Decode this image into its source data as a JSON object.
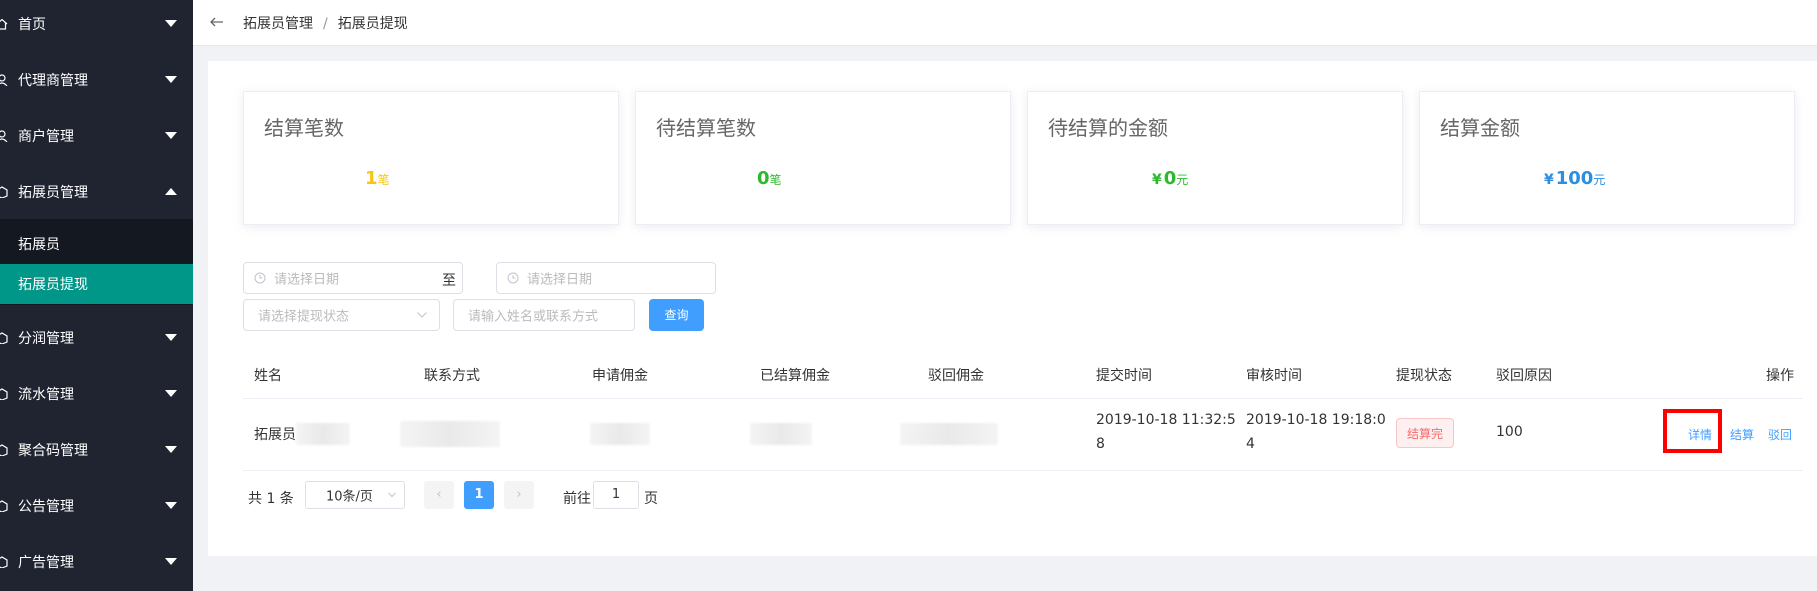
{
  "sidebar": {
    "menu": [
      {
        "label": "首页",
        "icon": "home-icon",
        "expanded": false
      },
      {
        "label": "代理商管理",
        "icon": "user-icon",
        "expanded": false
      },
      {
        "label": "商户管理",
        "icon": "user-icon",
        "expanded": false
      },
      {
        "label": "拓展员管理",
        "icon": "box-icon",
        "expanded": true
      },
      {
        "label": "分润管理",
        "icon": "box-icon",
        "expanded": false
      },
      {
        "label": "流水管理",
        "icon": "box-icon",
        "expanded": false
      },
      {
        "label": "聚合码管理",
        "icon": "box-icon",
        "expanded": false
      },
      {
        "label": "公告管理",
        "icon": "box-icon",
        "expanded": false
      },
      {
        "label": "广告管理",
        "icon": "box-icon",
        "expanded": false
      }
    ],
    "submenu": [
      {
        "label": "拓展员",
        "active": false
      },
      {
        "label": "拓展员提现",
        "active": true
      }
    ]
  },
  "header": {
    "breadcrumb": [
      "拓展员管理",
      "拓展员提现"
    ],
    "separator": "/"
  },
  "stats": [
    {
      "title": "结算笔数",
      "value": "1",
      "unit": "笔",
      "currency": "",
      "color": "#f5c518"
    },
    {
      "title": "待结算笔数",
      "value": "0",
      "unit": "笔",
      "currency": "",
      "color": "#2eb82e"
    },
    {
      "title": "待结算的金额",
      "value": "0",
      "unit": "元",
      "currency": "¥",
      "color": "#2eb82e"
    },
    {
      "title": "结算金额",
      "value": "100",
      "unit": "元",
      "currency": "¥",
      "color": "#2b8ee0"
    }
  ],
  "filters": {
    "date_start_placeholder": "请选择日期",
    "to_label": "至",
    "date_end_placeholder": "请选择日期",
    "status_placeholder": "请选择提现状态",
    "keyword_placeholder": "请输入姓名或联系方式",
    "query_button": "查询"
  },
  "table": {
    "columns": [
      "姓名",
      "联系方式",
      "申请佣金",
      "已结算佣金",
      "驳回佣金",
      "提交时间",
      "审核时间",
      "提现状态",
      "驳回原因",
      "操作"
    ],
    "rows": [
      {
        "name": "拓展员",
        "submit_time_1": "2019-10-18 11:32:5",
        "submit_time_2": "8",
        "review_time_1": "2019-10-18 19:18:0",
        "review_time_2": "4",
        "status": "结算完",
        "reject_reason": "100",
        "actions": [
          "详情",
          "结算",
          "驳回"
        ]
      }
    ]
  },
  "pagination": {
    "total_text": "共 1 条",
    "page_size": "10条/页",
    "current_page": "1",
    "goto_label": "前往",
    "goto_value": "1",
    "page_suffix": "页",
    "prev": "‹",
    "next": "›"
  },
  "colors": {
    "sidebar_bg": "#1f2430",
    "active_menu": "#009688",
    "primary": "#409eff",
    "danger": "#f56c6c",
    "highlight": "#ff0000"
  }
}
